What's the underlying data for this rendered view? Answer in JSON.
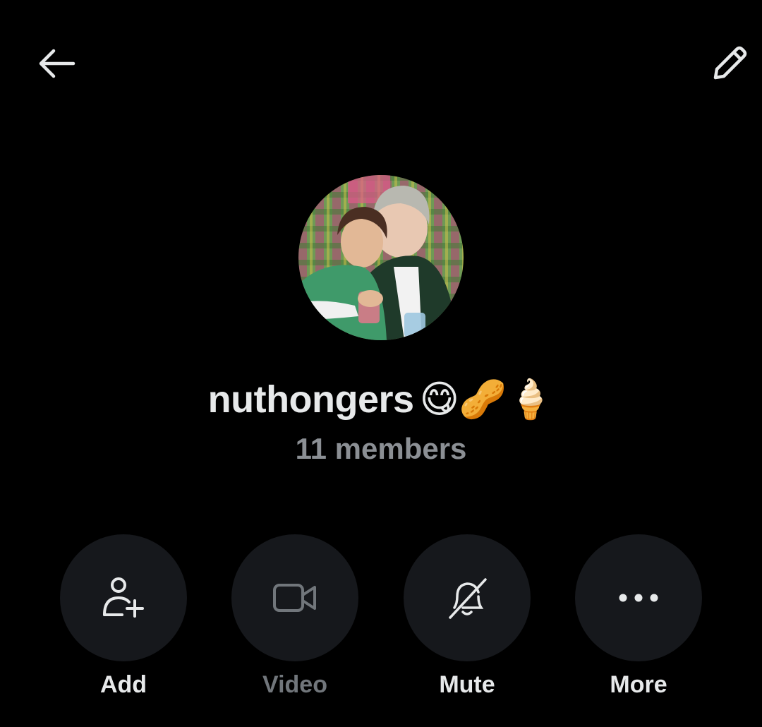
{
  "header": {
    "back_icon": "arrow-left-icon",
    "edit_icon": "pencil-icon"
  },
  "group": {
    "name": "nuthongers",
    "emoji": "😋🥜🍦",
    "member_count": "11 members",
    "avatar_icon": "group-avatar-photo"
  },
  "actions": [
    {
      "label": "Add",
      "icon": "add-user-icon",
      "enabled": true
    },
    {
      "label": "Video",
      "icon": "video-camera-icon",
      "enabled": false
    },
    {
      "label": "Mute",
      "icon": "bell-off-icon",
      "enabled": true
    },
    {
      "label": "More",
      "icon": "more-horizontal-icon",
      "enabled": true
    }
  ],
  "colors": {
    "background": "#000000",
    "text_primary": "#e7e9ea",
    "text_secondary": "#8b8f94",
    "text_disabled": "#71767b",
    "button_bg": "#16181c"
  }
}
